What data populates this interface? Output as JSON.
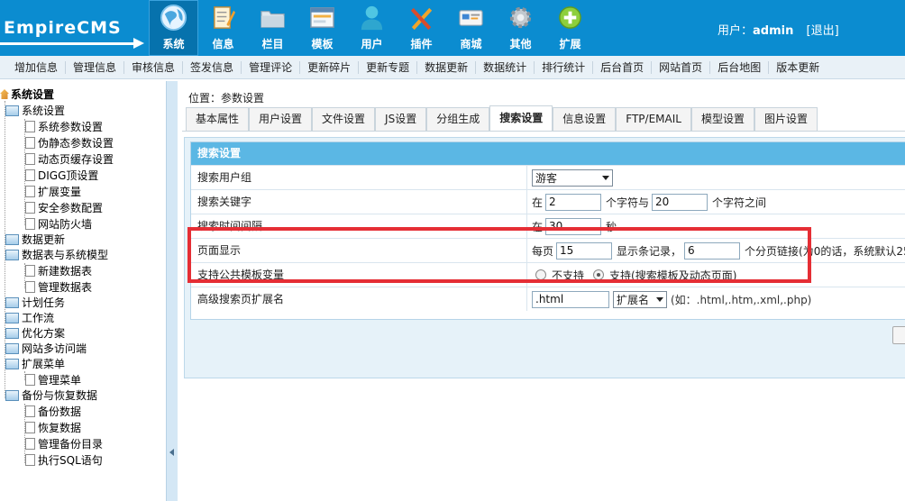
{
  "header": {
    "logo_text": "EmpireCMS",
    "nav": [
      {
        "label": "系统",
        "icon": "globe-icon",
        "active": true
      },
      {
        "label": "信息",
        "icon": "notepad-icon",
        "active": false
      },
      {
        "label": "栏目",
        "icon": "folder-icon",
        "active": false
      },
      {
        "label": "模板",
        "icon": "window-icon",
        "active": false
      },
      {
        "label": "用户",
        "icon": "user-icon",
        "active": false
      },
      {
        "label": "插件",
        "icon": "tools-icon",
        "active": false
      },
      {
        "label": "商城",
        "icon": "card-icon",
        "active": false
      },
      {
        "label": "其他",
        "icon": "gear-icon",
        "active": false
      },
      {
        "label": "扩展",
        "icon": "plus-icon",
        "active": false
      }
    ],
    "user_prefix": "用户：",
    "username": "admin",
    "logout": "[退出]"
  },
  "toolbar": [
    "增加信息",
    "管理信息",
    "审核信息",
    "签发信息",
    "管理评论",
    "更新碎片",
    "更新专题",
    "数据更新",
    "数据统计",
    "排行统计",
    "后台首页",
    "网站首页",
    "后台地图",
    "版本更新"
  ],
  "sidebar": {
    "root": "系统设置",
    "items": [
      {
        "label": "系统设置",
        "type": "folder"
      },
      {
        "label": "系统参数设置",
        "type": "doc"
      },
      {
        "label": "伪静态参数设置",
        "type": "doc"
      },
      {
        "label": "动态页缓存设置",
        "type": "doc"
      },
      {
        "label": "DIGG顶设置",
        "type": "doc"
      },
      {
        "label": "扩展变量",
        "type": "doc"
      },
      {
        "label": "安全参数配置",
        "type": "doc"
      },
      {
        "label": "网站防火墙",
        "type": "doc"
      },
      {
        "label": "数据更新",
        "type": "folder"
      },
      {
        "label": "数据表与系统模型",
        "type": "folder"
      },
      {
        "label": "新建数据表",
        "type": "doc"
      },
      {
        "label": "管理数据表",
        "type": "doc"
      },
      {
        "label": "计划任务",
        "type": "folder"
      },
      {
        "label": "工作流",
        "type": "folder"
      },
      {
        "label": "优化方案",
        "type": "folder"
      },
      {
        "label": "网站多访问端",
        "type": "folder"
      },
      {
        "label": "扩展菜单",
        "type": "folder"
      },
      {
        "label": "管理菜单",
        "type": "doc"
      },
      {
        "label": "备份与恢复数据",
        "type": "folder"
      },
      {
        "label": "备份数据",
        "type": "doc"
      },
      {
        "label": "恢复数据",
        "type": "doc"
      },
      {
        "label": "管理备份目录",
        "type": "doc"
      },
      {
        "label": "执行SQL语句",
        "type": "doc"
      }
    ]
  },
  "main": {
    "location": "位置：参数设置",
    "tabs": [
      "基本属性",
      "用户设置",
      "文件设置",
      "JS设置",
      "分组生成",
      "搜索设置",
      "信息设置",
      "FTP/EMAIL",
      "模型设置",
      "图片设置"
    ],
    "active_tab": "搜索设置",
    "section_title": "搜索设置",
    "rows": {
      "group": {
        "label": "搜索用户组",
        "value": "游客"
      },
      "keyword": {
        "label": "搜索关键字",
        "prefix": "在",
        "min": "2",
        "mid": "个字符与",
        "max": "20",
        "suffix": "个字符之间"
      },
      "interval": {
        "label": "搜索时间间隔",
        "prefix": "在",
        "value": "30",
        "suffix": "秒"
      },
      "page": {
        "label": "页面显示",
        "prefix": "每页",
        "per_page": "15",
        "mid": "显示条记录，",
        "links": "6",
        "suffix": "个分页链接(为0的话，系统默认25"
      },
      "public_var": {
        "label": "支持公共模板变量",
        "opt_no": "不支持",
        "opt_yes": "支持(搜索模板及动态页面)"
      },
      "ext": {
        "label": "高级搜索页扩展名",
        "value": ".html",
        "select": "扩展名",
        "hint": "(如：.html,.htm,.xml,.php)"
      }
    }
  },
  "colors": {
    "topbar": "#0b8cd0",
    "panel_header": "#5bb7e4",
    "highlight": "#e52e35"
  }
}
